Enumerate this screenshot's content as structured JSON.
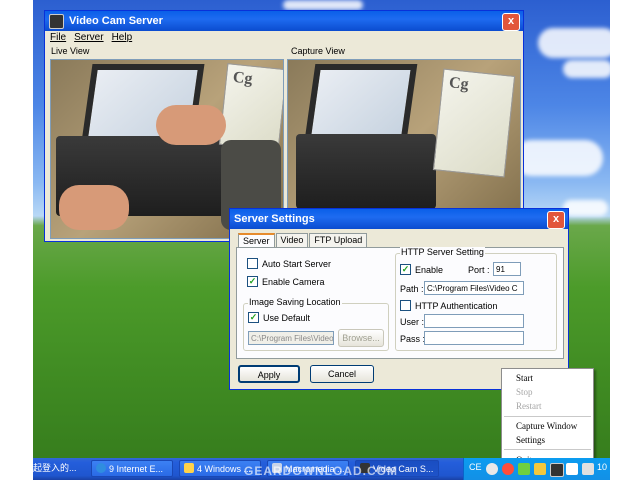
{
  "main_window": {
    "title": "Video Cam Server",
    "menu": [
      "File",
      "Server",
      "Help"
    ],
    "live_view_label": "Live View",
    "capture_view_label": "Capture View",
    "book_text": "Cg"
  },
  "settings_dialog": {
    "title": "Server Settings",
    "tabs": [
      "Server",
      "Video",
      "FTP Upload"
    ],
    "auto_start_label": "Auto Start Server",
    "auto_start_checked": false,
    "enable_camera_label": "Enable Camera",
    "enable_camera_checked": true,
    "image_saving_group": "Image Saving Location",
    "use_default_label": "Use Default",
    "use_default_checked": true,
    "image_path_value": "C:\\Program Files\\Video",
    "browse_label": "Browse...",
    "http_group": "HTTP Server Setting",
    "http_enable_label": "Enable",
    "http_enable_checked": true,
    "port_label": "Port :",
    "port_value": "91",
    "path_label": "Path :",
    "http_path_value": "C:\\Program Files\\Video C",
    "http_auth_label": "HTTP Authentication",
    "http_auth_checked": false,
    "user_label": "User :",
    "user_value": "",
    "pass_label": "Pass :",
    "pass_value": "",
    "apply_label": "Apply",
    "cancel_label": "Cancel"
  },
  "context_menu": {
    "items": [
      {
        "label": "Start",
        "enabled": true
      },
      {
        "label": "Stop",
        "enabled": false
      },
      {
        "label": "Restart",
        "enabled": false
      },
      {
        "label": "Capture Window",
        "enabled": true
      },
      {
        "label": "Settings",
        "enabled": true
      },
      {
        "label": "Quit",
        "enabled": true
      }
    ]
  },
  "taskbar": {
    "buttons": [
      {
        "label": "起登入的..."
      },
      {
        "label": "9 Internet E..."
      },
      {
        "label": "4 Windows ..."
      },
      {
        "label": "Macromedia ..."
      },
      {
        "label": "Video Cam S..."
      }
    ],
    "tray_lang": "CE",
    "clock": "10"
  },
  "desktop": {
    "close_glyph": "x"
  },
  "watermark": "GEARDOWNLOAD.COM"
}
